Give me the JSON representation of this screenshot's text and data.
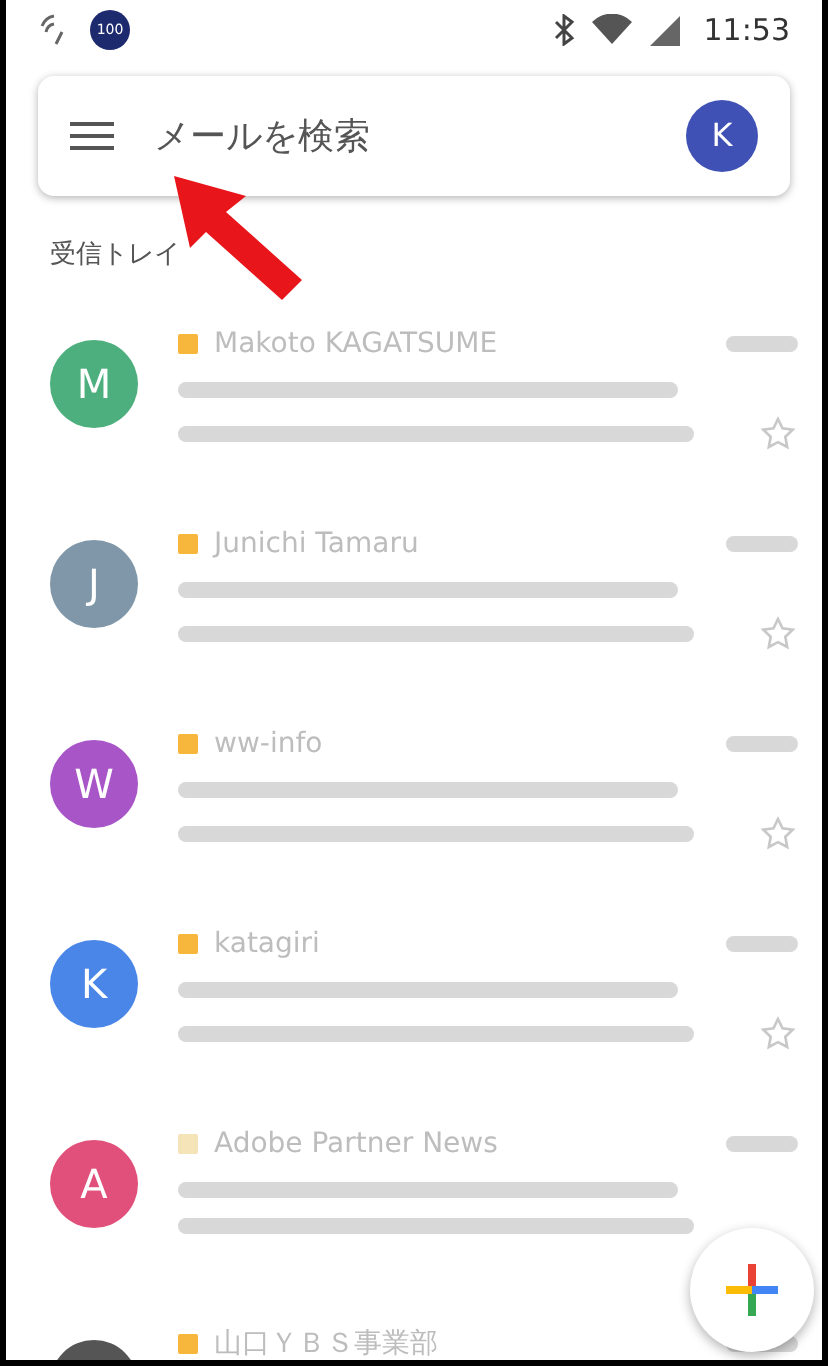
{
  "status_bar": {
    "badge": "100",
    "time": "11:53"
  },
  "search": {
    "placeholder": "メールを検索",
    "account_initial": "K"
  },
  "folder_title": "受信トレイ",
  "emails": [
    {
      "sender": "Makoto KAGATSUME",
      "initial": "M",
      "color": "#4caf7d",
      "important": true
    },
    {
      "sender": "Junichi Tamaru",
      "initial": "J",
      "color": "#7f97a8",
      "important": true
    },
    {
      "sender": "ww-info",
      "initial": "W",
      "color": "#a855c8",
      "important": true
    },
    {
      "sender": "katagiri",
      "initial": "K",
      "color": "#4a86e8",
      "important": true
    },
    {
      "sender": "Adobe Partner News",
      "initial": "A",
      "color": "#e0507a",
      "important": false
    },
    {
      "sender": "山口ＹＢＳ事業部",
      "color": "#555555",
      "important": true
    }
  ]
}
